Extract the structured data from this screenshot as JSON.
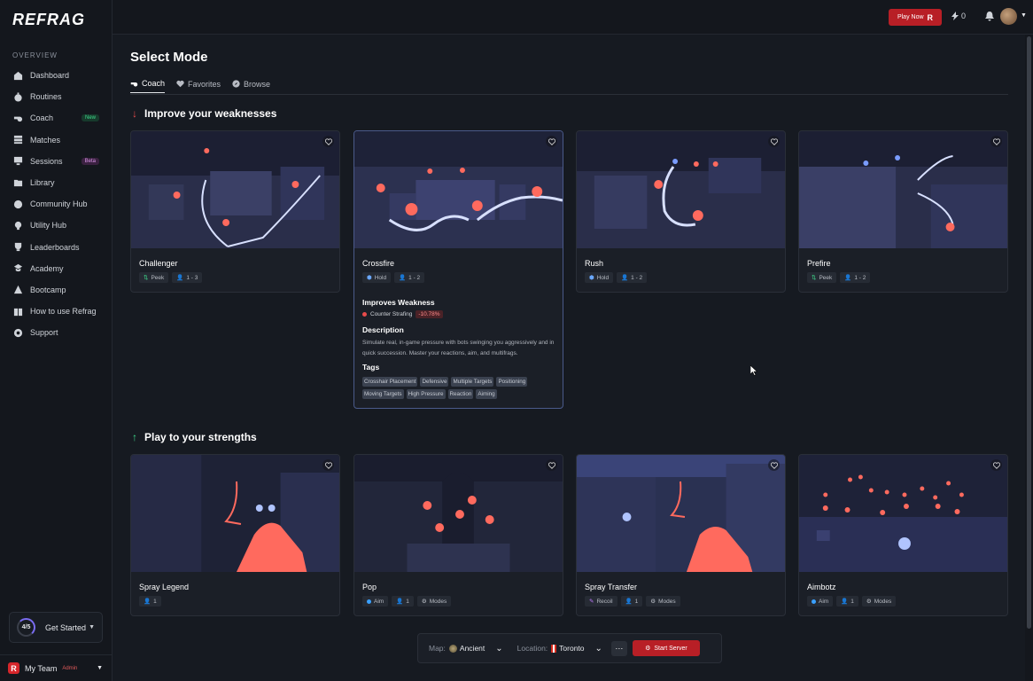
{
  "app": {
    "logo": "REFRAG"
  },
  "sidebar": {
    "section": "OVERVIEW",
    "items": [
      {
        "label": "Dashboard",
        "icon": "home-icon"
      },
      {
        "label": "Routines",
        "icon": "stopwatch-icon"
      },
      {
        "label": "Coach",
        "icon": "whistle-icon",
        "badge": "New"
      },
      {
        "label": "Matches",
        "icon": "stack-icon"
      },
      {
        "label": "Sessions",
        "icon": "monitor-icon",
        "badge": "Beta"
      },
      {
        "label": "Library",
        "icon": "folder-icon"
      },
      {
        "label": "Community Hub",
        "icon": "globe-icon"
      },
      {
        "label": "Utility Hub",
        "icon": "bulb-icon"
      },
      {
        "label": "Leaderboards",
        "icon": "trophy-icon"
      },
      {
        "label": "Academy",
        "icon": "graduation-cap-icon"
      },
      {
        "label": "Bootcamp",
        "icon": "warning-triangle-icon"
      },
      {
        "label": "How to use Refrag",
        "icon": "book-icon"
      },
      {
        "label": "Support",
        "icon": "lifebuoy-icon"
      }
    ],
    "get_started": {
      "progress": "4/5",
      "label": "Get Started"
    },
    "team": {
      "logo_letter": "R",
      "name": "My Team",
      "role": "Admin"
    }
  },
  "topbar": {
    "play_label": "Play Now",
    "play_icon_letter": "R",
    "energy": "0"
  },
  "page": {
    "title": "Select Mode",
    "tabs": [
      {
        "label": "Coach",
        "icon": "whistle-icon",
        "active": true
      },
      {
        "label": "Favorites",
        "icon": "heart-icon",
        "active": false
      },
      {
        "label": "Browse",
        "icon": "compass-icon",
        "active": false
      }
    ]
  },
  "sections": {
    "weaknesses": {
      "title": "Improve your weaknesses"
    },
    "strengths": {
      "title": "Play to your strengths"
    }
  },
  "cards": {
    "challenger": {
      "title": "Challenger",
      "chips": [
        "Peek",
        "1 - 3"
      ]
    },
    "crossfire": {
      "title": "Crossfire",
      "chips": [
        "Hold",
        "1 - 2"
      ],
      "improves_heading": "Improves Weakness",
      "weakness": "Counter Strafing",
      "weakness_pct": "-10.78%",
      "description_heading": "Description",
      "description": "Simulate real, in-game pressure with bots swinging you aggressively and in quick succession. Master your reactions, aim, and multifrags.",
      "tags_heading": "Tags",
      "tags": [
        "Crosshair Placement",
        "Defensive",
        "Multiple Targets",
        "Positioning",
        "Moving Targets",
        "High Pressure",
        "Reaction",
        "Aiming"
      ]
    },
    "rush": {
      "title": "Rush",
      "chips": [
        "Hold",
        "1 - 2"
      ]
    },
    "prefire": {
      "title": "Prefire",
      "chips": [
        "Peek",
        "1 - 2"
      ]
    },
    "spray_legend": {
      "title": "Spray Legend",
      "chips": [
        "1"
      ]
    },
    "pop": {
      "title": "Pop",
      "chips": [
        "Aim",
        "1",
        "Modes"
      ]
    },
    "spray_transfer": {
      "title": "Spray Transfer",
      "chips": [
        "Recoil",
        "1",
        "Modes"
      ]
    },
    "aimbotz": {
      "title": "Aimbotz",
      "chips": [
        "Aim",
        "1",
        "Modes"
      ]
    }
  },
  "server": {
    "map_label": "Map:",
    "map_value": "Ancient",
    "location_label": "Location:",
    "location_value": "Toronto",
    "more": "···",
    "start_label": "Start Server"
  },
  "colors": {
    "accent_red": "#b81f26",
    "card_bg": "#1b1f27",
    "bg": "#161a21"
  }
}
